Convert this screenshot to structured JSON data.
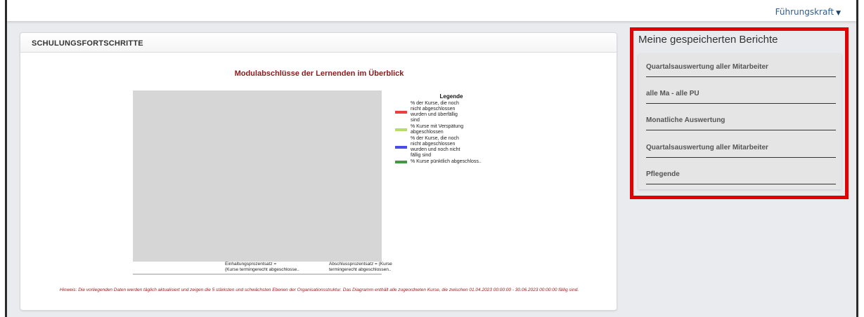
{
  "header": {
    "role_label": "Führungskraft"
  },
  "training_card": {
    "title": "SCHULUNGSFORTSCHRITTE",
    "chart_title": "Modulabschlüsse der Lernenden im Überblick",
    "hint": "Hinweis: Die vorliegenden Daten werden täglich aktualisiert und zeigen die 5 stärksten und schwächsten Ebenen der Organisationsstruktur. Das Diagramm enthält alle zugeordneten Kurse, die zwischen 01.04.2023 00:00:00 - 30.06.2023 00:00:00 fällig sind."
  },
  "chart_data": {
    "type": "bar",
    "title": "Modulabschlüsse der Lernenden im Überblick",
    "categories": [
      "Einhaltungsprozentsatz =\n(Kurse  termingerecht  abgeschlosse..",
      "Abschlussprozentsatz = (Kurse\ntermingerecht  abgeschlossen.."
    ],
    "legend_title": "Legende",
    "series": [
      {
        "name": "% der Kurse, die noch\nnicht abgeschlossen\nwurden und überfällig\nsind",
        "color": "#ee3f3f"
      },
      {
        "name": "% Kurse mit Verspätung\nabgeschlossen",
        "color": "#b6dc6e"
      },
      {
        "name": "% der Kurse, die noch\nnicht abgeschlossen\nwurden und noch nicht\nfällig sind",
        "color": "#4a4ce8"
      },
      {
        "name": "% Kurse pünktlich abgeschloss..",
        "color": "#3f9a3f"
      }
    ],
    "legend_position": "right"
  },
  "reports": {
    "title": "Meine gespeicherten Berichte",
    "items": [
      "Quartalsauswertung aller Mitarbeiter",
      "alle Ma - alle PU",
      "Monatliche Auswertung",
      "Quartalsauswertung aller Mitarbeiter",
      "Pflegende"
    ],
    "highlight_color": "#e40000"
  }
}
